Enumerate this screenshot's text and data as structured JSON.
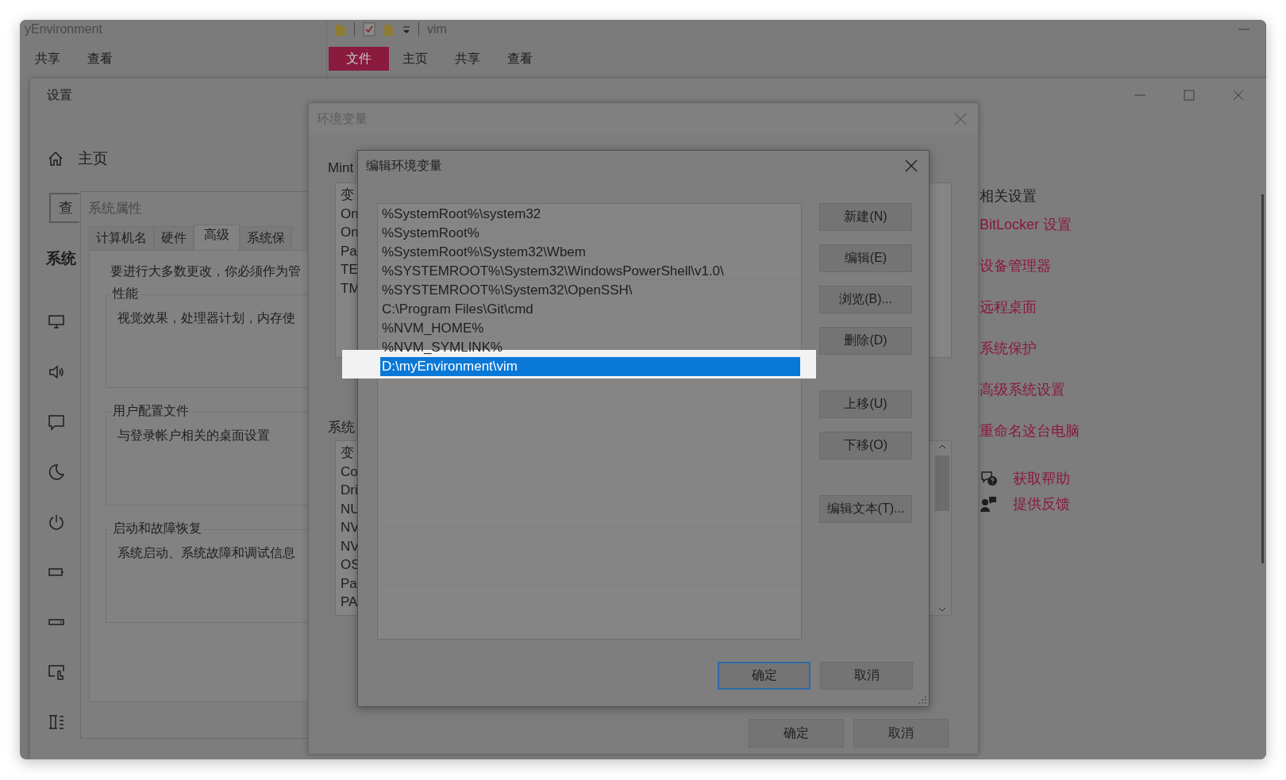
{
  "explorer_left": {
    "title": "yEnvironment",
    "tabs": [
      {
        "label": "共享",
        "selected": false
      },
      {
        "label": "查看",
        "selected": false
      }
    ]
  },
  "explorer_right": {
    "title": "vim",
    "tabs": [
      {
        "label": "文件",
        "selected": true
      },
      {
        "label": "主页",
        "selected": false
      },
      {
        "label": "共享",
        "selected": false
      },
      {
        "label": "查看",
        "selected": false
      }
    ]
  },
  "settings": {
    "title": "设置",
    "home": "主页",
    "search": {
      "placeholder": "查"
    },
    "section": "系统",
    "related_title": "相关设置",
    "links": [
      "BitLocker 设置",
      "设备管理器",
      "远程桌面",
      "系统保护",
      "高级系统设置",
      "重命名这台电脑"
    ],
    "help_links": [
      {
        "label": "获取帮助",
        "kind": "help"
      },
      {
        "label": "提供反馈",
        "kind": "feedback"
      }
    ]
  },
  "system_properties": {
    "title": "系统属性",
    "tabs": [
      {
        "label": "计算机名",
        "selected": false
      },
      {
        "label": "硬件",
        "selected": false
      },
      {
        "label": "高级",
        "selected": true
      },
      {
        "label": "系统保",
        "selected": false
      }
    ],
    "note": "要进行大多数更改，你必须作为管",
    "groups": [
      {
        "title": "性能",
        "text": "视觉效果，处理器计划，内存使"
      },
      {
        "title": "用户配置文件",
        "text": "与登录帐户相关的桌面设置"
      },
      {
        "title": "启动和故障恢复",
        "text": "系统启动、系统故障和调试信息"
      }
    ]
  },
  "environment_variables": {
    "title": "环境变量",
    "user_label": "Mint",
    "user_rows": [
      "变",
      "On",
      "On",
      "Pa",
      "TE",
      "TM"
    ],
    "system_label": "系统",
    "system_rows": [
      "变",
      "Co",
      "Dri",
      "NU",
      "NV",
      "NV",
      "OS",
      "Pa",
      "PA"
    ],
    "buttons": [
      "确定",
      "取消"
    ]
  },
  "edit_dialog": {
    "title": "编辑环境变量",
    "entries": [
      {
        "text": "%SystemRoot%\\system32",
        "selected": false
      },
      {
        "text": "%SystemRoot%",
        "selected": false
      },
      {
        "text": "%SystemRoot%\\System32\\Wbem",
        "selected": false
      },
      {
        "text": "%SYSTEMROOT%\\System32\\WindowsPowerShell\\v1.0\\",
        "selected": false
      },
      {
        "text": "%SYSTEMROOT%\\System32\\OpenSSH\\",
        "selected": false
      },
      {
        "text": "C:\\Program Files\\Git\\cmd",
        "selected": false
      },
      {
        "text": "%NVM_HOME%",
        "selected": false
      },
      {
        "text": "%NVM_SYMLINK%",
        "selected": false
      },
      {
        "text": "D:\\myEnvironment\\vim",
        "selected": true
      }
    ],
    "side_buttons": [
      "新建(N)",
      "编辑(E)",
      "浏览(B)...",
      "删除(D)",
      "上移(U)",
      "下移(O)",
      "编辑文本(T)..."
    ],
    "buttons": [
      {
        "label": "确定",
        "default": true
      },
      {
        "label": "取消",
        "default": false
      }
    ]
  }
}
